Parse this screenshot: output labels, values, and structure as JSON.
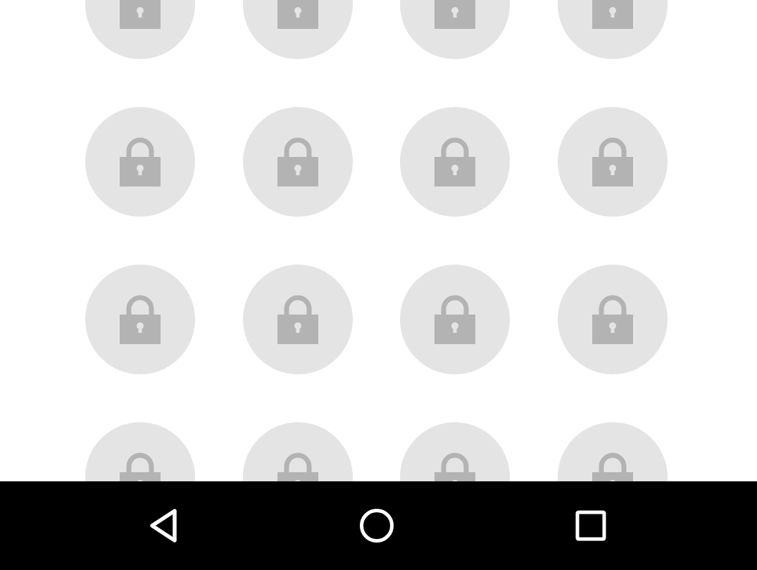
{
  "lock_grid": {
    "tiles": [
      {
        "icon": "lock-icon",
        "state": "locked"
      },
      {
        "icon": "lock-icon",
        "state": "locked"
      },
      {
        "icon": "lock-icon",
        "state": "locked"
      },
      {
        "icon": "lock-icon",
        "state": "locked"
      },
      {
        "icon": "lock-icon",
        "state": "locked"
      },
      {
        "icon": "lock-icon",
        "state": "locked"
      },
      {
        "icon": "lock-icon",
        "state": "locked"
      },
      {
        "icon": "lock-icon",
        "state": "locked"
      },
      {
        "icon": "lock-icon",
        "state": "locked"
      },
      {
        "icon": "lock-icon",
        "state": "locked"
      },
      {
        "icon": "lock-icon",
        "state": "locked"
      },
      {
        "icon": "lock-icon",
        "state": "locked"
      },
      {
        "icon": "lock-icon",
        "state": "locked"
      },
      {
        "icon": "lock-icon",
        "state": "locked"
      },
      {
        "icon": "lock-icon",
        "state": "locked"
      },
      {
        "icon": "lock-icon",
        "state": "locked"
      }
    ]
  },
  "navigation_bar": {
    "buttons": [
      {
        "name": "back",
        "icon": "back-triangle-icon"
      },
      {
        "name": "home",
        "icon": "home-circle-icon"
      },
      {
        "name": "recents",
        "icon": "recents-square-icon"
      }
    ]
  },
  "colors": {
    "background": "#ffffff",
    "tile_fill": "#e4e4e4",
    "lock_fill": "#b3b3b3",
    "nav_bar": "#000000",
    "nav_icon": "#ffffff"
  }
}
